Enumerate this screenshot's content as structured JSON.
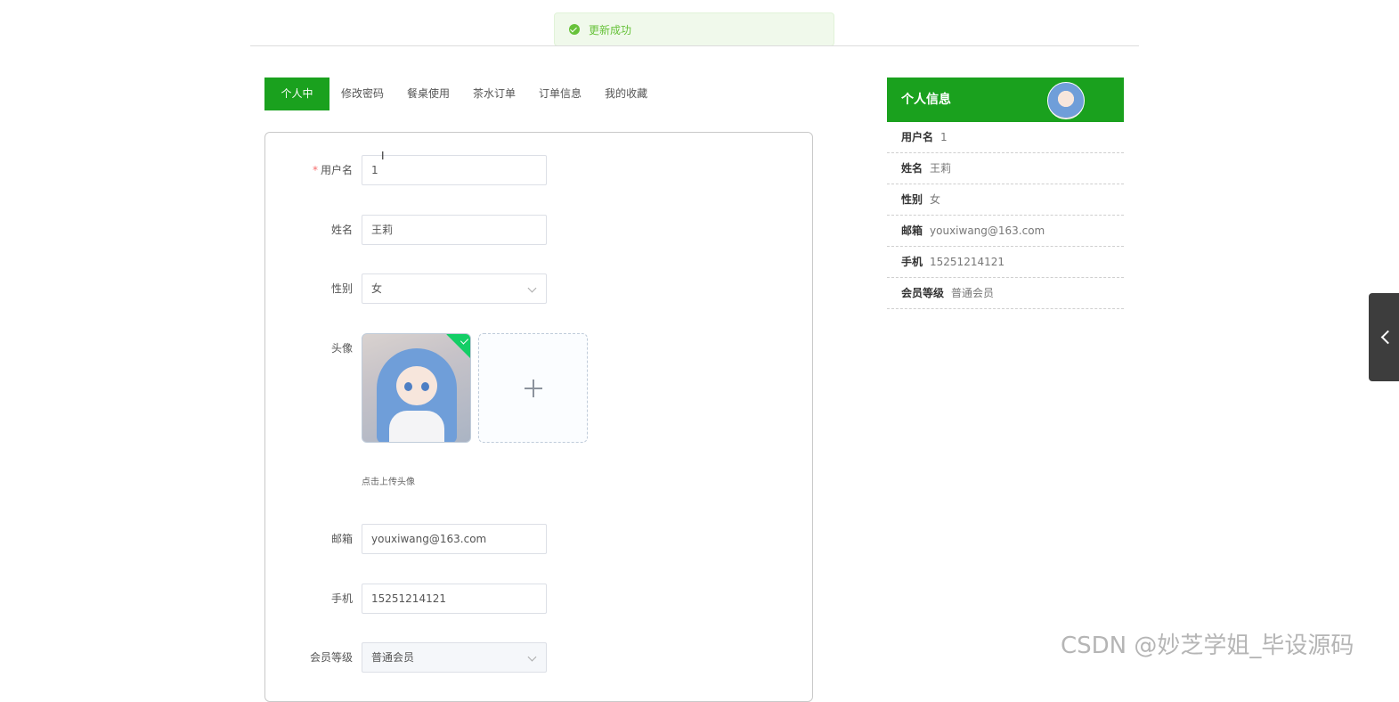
{
  "toast": {
    "message": "更新成功",
    "icon": "check-circle-icon",
    "color": "#67c23a"
  },
  "tabs": [
    {
      "label": "个人中心",
      "active": true
    },
    {
      "label": "修改密码",
      "active": false
    },
    {
      "label": "餐桌使用",
      "active": false
    },
    {
      "label": "茶水订单",
      "active": false
    },
    {
      "label": "订单信息",
      "active": false
    },
    {
      "label": "我的收藏",
      "active": false
    }
  ],
  "form": {
    "username": {
      "label": "用户名",
      "required_mark": "*",
      "value": "1"
    },
    "name": {
      "label": "姓名",
      "value": "王莉"
    },
    "gender": {
      "label": "性别",
      "value": "女"
    },
    "avatar": {
      "label": "头像",
      "hint": "点击上传头像"
    },
    "email": {
      "label": "邮箱",
      "value": "youxiwang@163.com"
    },
    "phone": {
      "label": "手机",
      "value": "15251214121"
    },
    "member_level": {
      "label": "会员等级",
      "value": "普通会员"
    }
  },
  "info_panel": {
    "title": "个人信息",
    "rows": [
      {
        "key": "用户名",
        "value": "1"
      },
      {
        "key": "姓名",
        "value": "王莉"
      },
      {
        "key": "性别",
        "value": "女"
      },
      {
        "key": "邮箱",
        "value": "youxiwang@163.com"
      },
      {
        "key": "手机",
        "value": "15251214121"
      },
      {
        "key": "会员等级",
        "value": "普通会员"
      }
    ]
  },
  "colors": {
    "accent": "#1aa11e",
    "success": "#67c23a"
  },
  "watermark": "CSDN @妙芝学姐_毕设源码"
}
